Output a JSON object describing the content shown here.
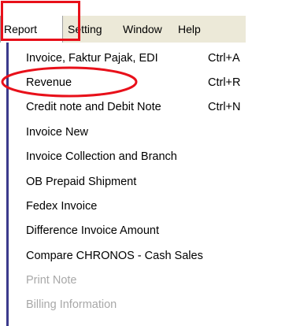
{
  "menubar": {
    "items": [
      {
        "label": "Report"
      },
      {
        "label": "Setting"
      },
      {
        "label": "Window"
      },
      {
        "label": "Help"
      }
    ]
  },
  "menu": {
    "items": [
      {
        "label": "Invoice, Faktur Pajak, EDI",
        "shortcut": "Ctrl+A",
        "enabled": true
      },
      {
        "label": "Revenue",
        "shortcut": "Ctrl+R",
        "enabled": true
      },
      {
        "label": "Credit note and Debit Note",
        "shortcut": "Ctrl+N",
        "enabled": true
      },
      {
        "label": "Invoice New",
        "shortcut": "",
        "enabled": true
      },
      {
        "label": "Invoice Collection and Branch",
        "shortcut": "",
        "enabled": true
      },
      {
        "label": "OB Prepaid Shipment",
        "shortcut": "",
        "enabled": true
      },
      {
        "label": "Fedex Invoice",
        "shortcut": "",
        "enabled": true
      },
      {
        "label": "Difference Invoice Amount",
        "shortcut": "",
        "enabled": true
      },
      {
        "label": "Compare CHRONOS - Cash Sales",
        "shortcut": "",
        "enabled": true
      },
      {
        "label": "Print Note",
        "shortcut": "",
        "enabled": false
      },
      {
        "label": "Billing Information",
        "shortcut": "",
        "enabled": false
      }
    ]
  },
  "annotations": {
    "color": "#e8101a"
  }
}
